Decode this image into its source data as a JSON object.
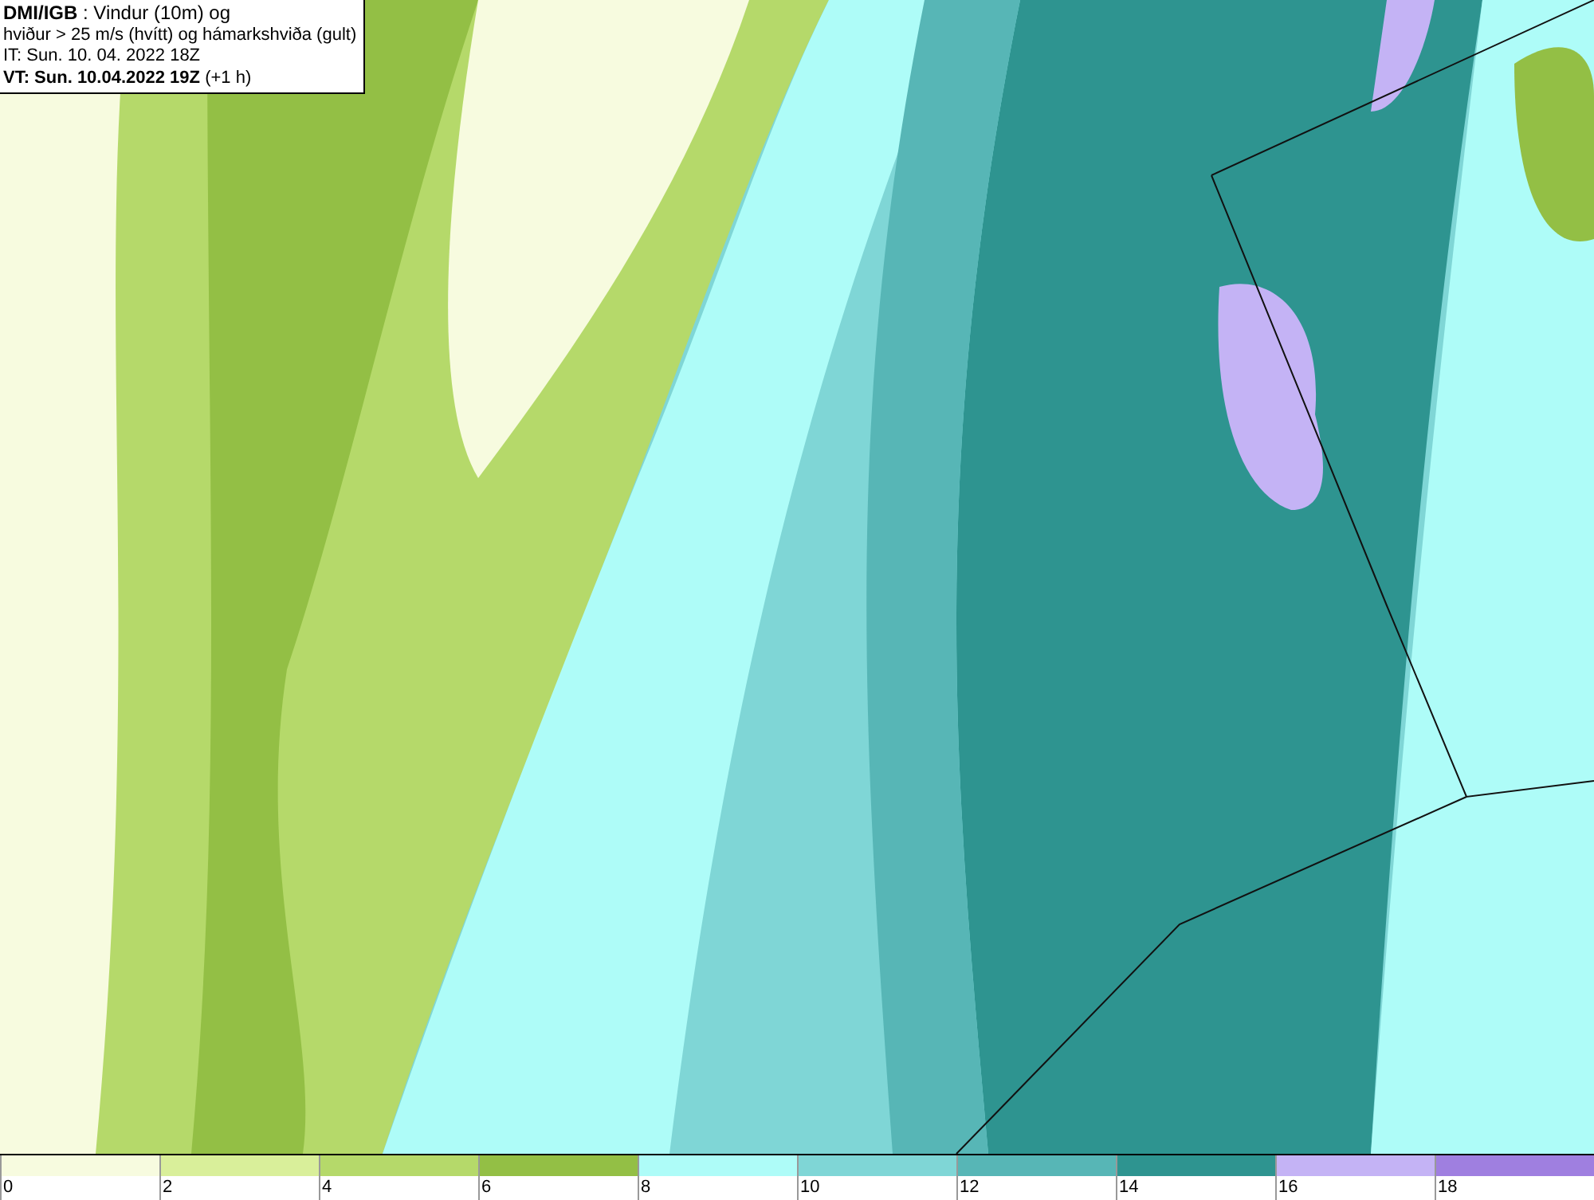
{
  "header": {
    "lines": [
      "**DMI/IGB** : Vindur (10m) og",
      "hviður > 25 m/s (hvítt) og hámarkshviða (gult)",
      "IT: Sun. 10. 04. 2022 18Z",
      "**VT: Sun. 10.04.2022 19Z** (+1 h)"
    ]
  },
  "legend": [
    {
      "label": "0",
      "color": "#f7fbdf"
    },
    {
      "label": "2",
      "color": "#d9ef9a"
    },
    {
      "label": "4",
      "color": "#b5d96a"
    },
    {
      "label": "6",
      "color": "#93bf45"
    },
    {
      "label": "8",
      "color": "#aefcf8"
    },
    {
      "label": "10",
      "color": "#7fd6d6"
    },
    {
      "label": "12",
      "color": "#57b6b6"
    },
    {
      "label": "14",
      "color": "#2e9490"
    },
    {
      "label": "16",
      "color": "#c4b3f5"
    },
    {
      "label": "18",
      "color": "#9f7fe0"
    }
  ]
}
